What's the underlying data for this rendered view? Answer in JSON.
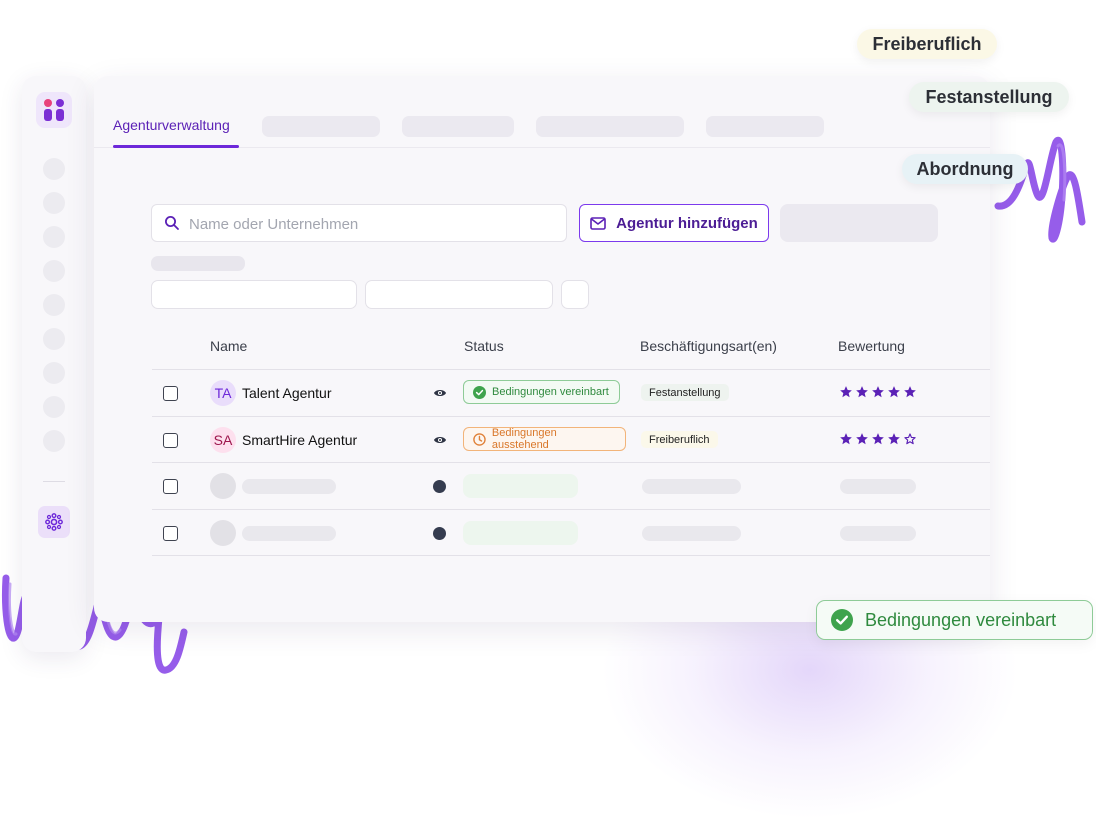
{
  "colors": {
    "brand": "#6d28d9",
    "success": "#2f8a3e",
    "warning": "#d9772a",
    "star": "#5b21b6"
  },
  "tabs": {
    "active_label": "Agenturverwaltung"
  },
  "toolbar": {
    "search_placeholder": "Name oder Unternehmen",
    "search_icon": "search-icon",
    "add_agency_label": "Agentur hinzufügen",
    "add_agency_icon": "mail-icon"
  },
  "table": {
    "columns": [
      "Name",
      "Status",
      "Beschäftigungsart(en)",
      "Bewertung"
    ],
    "rows": [
      {
        "initials": "TA",
        "name": "Talent Agentur",
        "status": "Bedingungen vereinbart",
        "status_icon": "check-circle-icon",
        "employment_type": "Festanstellung",
        "rating": 5,
        "rating_max": 5
      },
      {
        "initials": "SA",
        "name": "SmartHire Agentur",
        "status": "Bedingungen ausstehend",
        "status_icon": "clock-icon",
        "employment_type": "Freiberuflich",
        "rating": 4,
        "rating_max": 5
      }
    ]
  },
  "floating_tags": [
    "Freiberuflich",
    "Festanstellung",
    "Abordnung"
  ],
  "floating_badge": {
    "label": "Bedingungen vereinbart",
    "icon": "check-circle-icon"
  }
}
